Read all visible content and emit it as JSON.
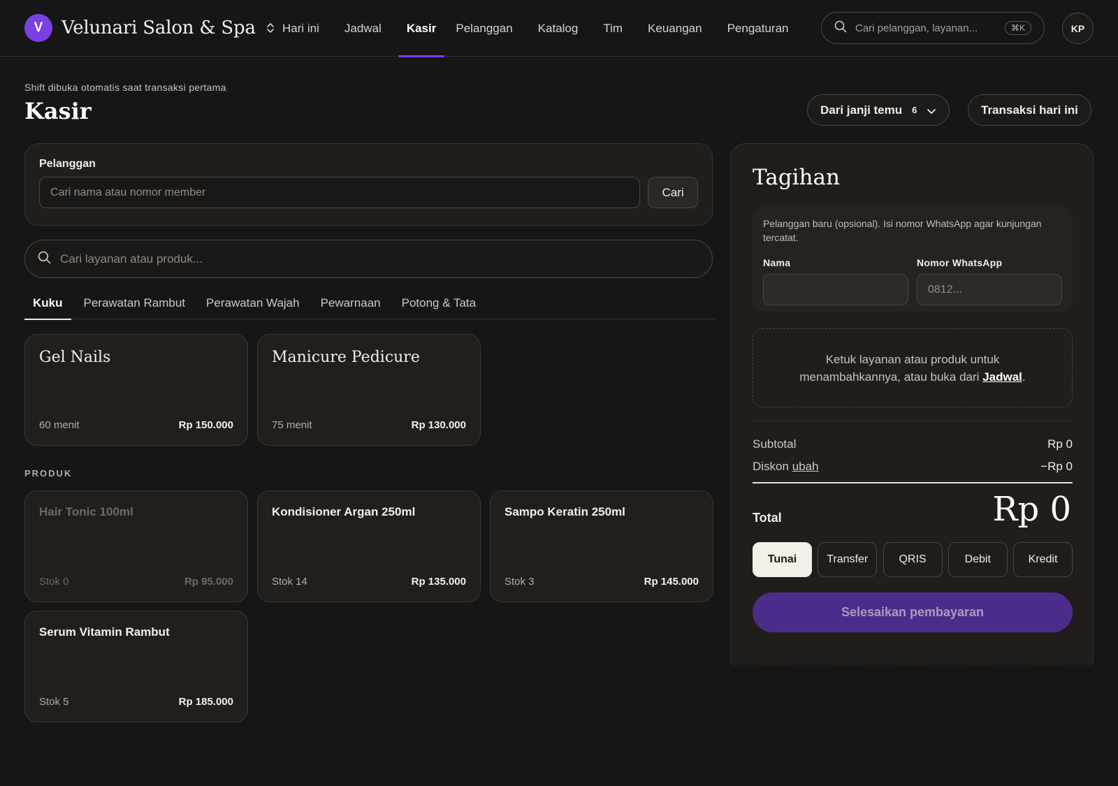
{
  "brand": {
    "initial": "V",
    "name": "Velunari Salon & Spa"
  },
  "nav": {
    "items": [
      {
        "label": "Hari ini"
      },
      {
        "label": "Jadwal"
      },
      {
        "label": "Kasir",
        "active": true
      },
      {
        "label": "Pelanggan"
      },
      {
        "label": "Katalog"
      },
      {
        "label": "Tim"
      },
      {
        "label": "Keuangan"
      },
      {
        "label": "Pengaturan"
      }
    ]
  },
  "global_search": {
    "placeholder": "Cari pelanggan, layanan...",
    "shortcut": "⌘K"
  },
  "user": {
    "initials": "KP"
  },
  "page": {
    "note": "Shift dibuka otomatis saat transaksi pertama",
    "title": "Kasir",
    "from_appointments": {
      "label": "Dari janji temu",
      "count": "6"
    },
    "today_transactions": "Transaksi hari ini"
  },
  "customer": {
    "label": "Pelanggan",
    "placeholder": "Cari nama atau nomor member",
    "search_button": "Cari"
  },
  "catalog_search": {
    "placeholder": "Cari layanan atau produk..."
  },
  "tabs": [
    {
      "label": "Kuku",
      "active": true
    },
    {
      "label": "Perawatan Rambut"
    },
    {
      "label": "Perawatan Wajah"
    },
    {
      "label": "Pewarnaan"
    },
    {
      "label": "Potong & Tata"
    }
  ],
  "services": [
    {
      "name": "Gel Nails",
      "duration": "60 menit",
      "price": "Rp 150.000"
    },
    {
      "name": "Manicure Pedicure",
      "duration": "75 menit",
      "price": "Rp 130.000"
    }
  ],
  "products_label": "PRODUK",
  "products": [
    {
      "name": "Hair Tonic 100ml",
      "stock": "Stok 0",
      "price": "Rp 95.000",
      "disabled": true
    },
    {
      "name": "Kondisioner Argan 250ml",
      "stock": "Stok 14",
      "price": "Rp 135.000"
    },
    {
      "name": "Sampo Keratin 250ml",
      "stock": "Stok 3",
      "price": "Rp 145.000"
    },
    {
      "name": "Serum Vitamin Rambut",
      "stock": "Stok 5",
      "price": "Rp 185.000"
    }
  ],
  "bill": {
    "title": "Tagihan",
    "new_customer_note": "Pelanggan baru (opsional). Isi nomor WhatsApp agar kunjungan tercatat.",
    "name_label": "Nama",
    "name_value": "",
    "phone_label": "Nomor WhatsApp",
    "phone_placeholder": "0812...",
    "hint_text": "Ketuk layanan atau produk untuk menambahkannya, atau buka dari",
    "hint_link": "Jadwal",
    "hint_end": ".",
    "subtotal_label": "Subtotal",
    "subtotal_value": "Rp 0",
    "discount_label": "Diskon",
    "discount_link": "ubah",
    "discount_value": "−Rp 0",
    "total_label": "Total",
    "total_value": "Rp 0",
    "payment_methods": [
      {
        "label": "Tunai",
        "active": true
      },
      {
        "label": "Transfer"
      },
      {
        "label": "QRIS"
      },
      {
        "label": "Debit"
      },
      {
        "label": "Kredit"
      }
    ],
    "finish_button": "Selesaikan pembayaran"
  },
  "colors": {
    "accent": "#7b3fe4",
    "finish_disabled": "#4b2c8a",
    "background": "#171616"
  }
}
